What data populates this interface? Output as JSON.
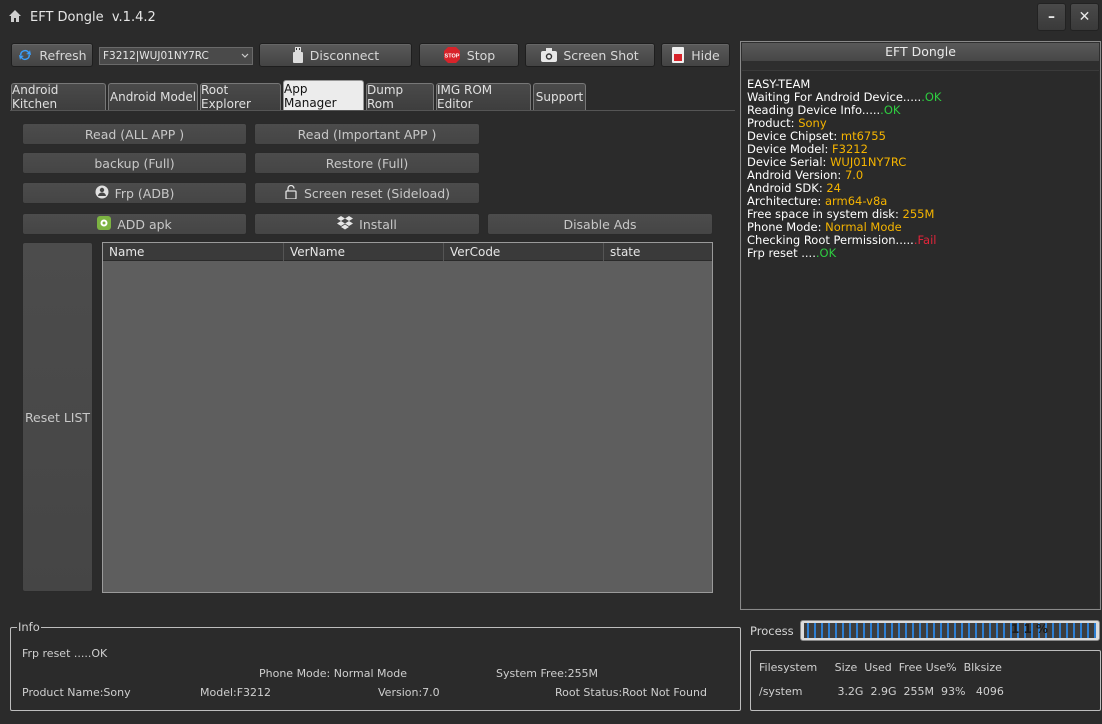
{
  "window": {
    "title": "EFT Dongle  v.1.4.2",
    "minimize_symbol": "–",
    "close_symbol": "✕"
  },
  "toolbar": {
    "refresh_label": "Refresh",
    "device_selected": "F3212|WUJ01NY7RC",
    "disconnect_label": "Disconnect",
    "stop_label": "Stop",
    "stop_icon_text": "STOP",
    "screenshot_label": "Screen Shot",
    "hide_label": "Hide"
  },
  "tabs": [
    {
      "label": "Android Kitchen"
    },
    {
      "label": "Android Model"
    },
    {
      "label": "Root Explorer"
    },
    {
      "label": "App Manager",
      "active": true
    },
    {
      "label": "Dump Rom"
    },
    {
      "label": "IMG ROM Editor"
    },
    {
      "label": "Support"
    }
  ],
  "app_manager": {
    "read_all_label": "Read (ALL APP )",
    "read_important_label": "Read (Important APP )",
    "backup_label": "backup (Full)",
    "restore_label": "Restore (Full)",
    "frp_label": "Frp (ADB)",
    "screen_reset_label": "Screen reset  (Sideload)",
    "add_apk_label": "ADD apk",
    "install_label": "Install",
    "disable_ads_label": "Disable Ads",
    "reset_list_label": "Reset LIST",
    "table": {
      "columns": [
        "Name",
        "VerName",
        "VerCode",
        "state"
      ],
      "rows": []
    }
  },
  "log": {
    "title": "EFT Dongle",
    "lines": [
      {
        "text": "EASY-TEAM",
        "value": ""
      },
      {
        "text": "Waiting For Android Device.....",
        "value": ".OK",
        "color": "#2ecc40"
      },
      {
        "text": "Reading Device Info.....",
        "value": ".OK",
        "color": "#2ecc40"
      },
      {
        "text": "Product: ",
        "value": "Sony",
        "color": "#f5b400"
      },
      {
        "text": "Device Chipset: ",
        "value": "mt6755",
        "color": "#f5b400"
      },
      {
        "text": "Device Model: ",
        "value": "F3212",
        "color": "#f5b400"
      },
      {
        "text": "Device Serial: ",
        "value": "WUJ01NY7RC",
        "color": "#f5b400"
      },
      {
        "text": "Android Version: ",
        "value": "7.0",
        "color": "#f5b400"
      },
      {
        "text": "Android SDK: ",
        "value": "24",
        "color": "#f5b400"
      },
      {
        "text": "Architecture: ",
        "value": "arm64-v8a",
        "color": "#f5b400"
      },
      {
        "text": "Free space in system disk: ",
        "value": "255M",
        "color": "#f5b400"
      },
      {
        "text": "Phone Mode: ",
        "value": "Normal Mode",
        "color": "#f5b400"
      },
      {
        "text": "Checking Root Permission.....",
        "value": ".Fail",
        "color": "#e0243a"
      },
      {
        "text": "Frp reset ....",
        "value": ".OK",
        "color": "#2ecc40"
      }
    ]
  },
  "info": {
    "legend": "Info",
    "frp_reset": "Frp reset .....OK",
    "phone_mode": "Phone Mode: Normal Mode",
    "system_free": "System Free:255M",
    "product_name": "Product Name:Sony",
    "model": "Model:F3212",
    "version": "Version:7.0",
    "root_status": "Root Status:Root Not Found"
  },
  "process": {
    "label": "Process",
    "percent_text": "1 1 %",
    "progress": 1.0
  },
  "filesystem": {
    "header": "Filesystem     Size  Used  Free Use%  Blksize",
    "row": "/system          3.2G  2.9G  255M  93%   4096"
  }
}
